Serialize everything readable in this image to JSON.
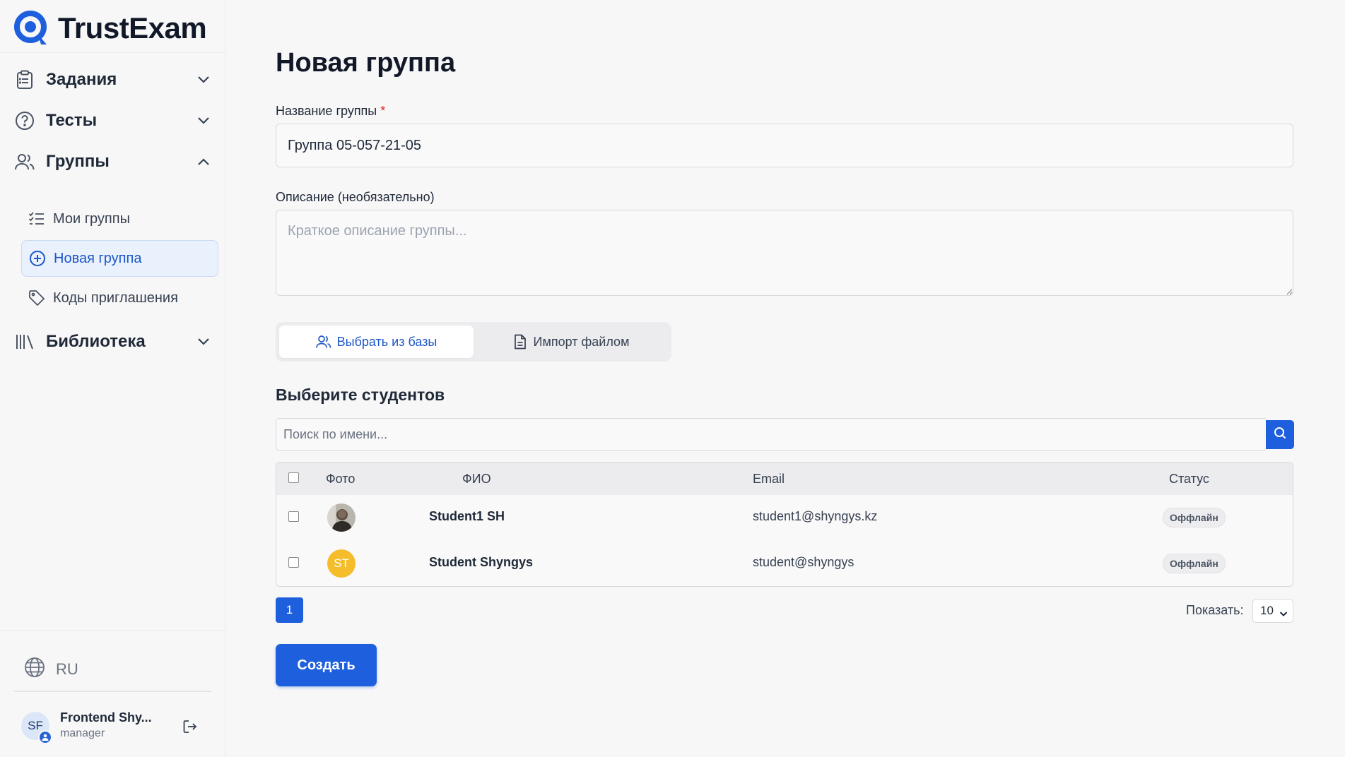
{
  "app": {
    "name": "TrustExam"
  },
  "colors": {
    "accent": "#1d5fdc",
    "active_bg": "#e9f1fc",
    "required": "#dc2626",
    "avatar_st": "#f5bd2a"
  },
  "sidebar": {
    "sections": [
      {
        "label": "Задания",
        "icon": "clipboard-icon",
        "expanded": false
      },
      {
        "label": "Тесты",
        "icon": "question-circle-icon",
        "expanded": false
      },
      {
        "label": "Группы",
        "icon": "users-icon",
        "expanded": true
      },
      {
        "label": "Библиотека",
        "icon": "library-icon",
        "expanded": false
      }
    ],
    "groups_items": [
      {
        "label": "Мои группы",
        "icon": "list-checks-icon",
        "active": false
      },
      {
        "label": "Новая группа",
        "icon": "plus-circle-icon",
        "active": true
      },
      {
        "label": "Коды приглашения",
        "icon": "tag-icon",
        "active": false
      }
    ],
    "language": "RU",
    "user": {
      "initials": "SF",
      "name": "Frontend Shy...",
      "role": "manager"
    }
  },
  "main": {
    "title": "Новая группа",
    "group_name": {
      "label": "Название группы",
      "required_mark": "*",
      "value": "Группа 05-057-21-05"
    },
    "description": {
      "label": "Описание (необязательно)",
      "placeholder": "Краткое описание группы..."
    },
    "tabs": [
      {
        "label": "Выбрать из базы",
        "icon": "users-icon",
        "active": true
      },
      {
        "label": "Импорт файлом",
        "icon": "file-icon",
        "active": false
      }
    ],
    "students_section": {
      "title": "Выберите студентов",
      "search_placeholder": "Поиск по имени...",
      "columns": {
        "photo": "Фото",
        "name": "ФИО",
        "email": "Email",
        "status": "Статус"
      },
      "rows": [
        {
          "photo": "photo",
          "initials": "",
          "name": "Student1 SH",
          "email": "student1@shyngys.kz",
          "status": "Оффлайн",
          "checked": false
        },
        {
          "photo": "initials",
          "initials": "ST",
          "name": "Student Shyngys",
          "email": "student@shyngys",
          "status": "Оффлайн",
          "checked": false
        }
      ]
    },
    "pagination": {
      "current_page": "1",
      "show_label": "Показать:",
      "page_size": "10"
    },
    "create_button": "Создать"
  }
}
